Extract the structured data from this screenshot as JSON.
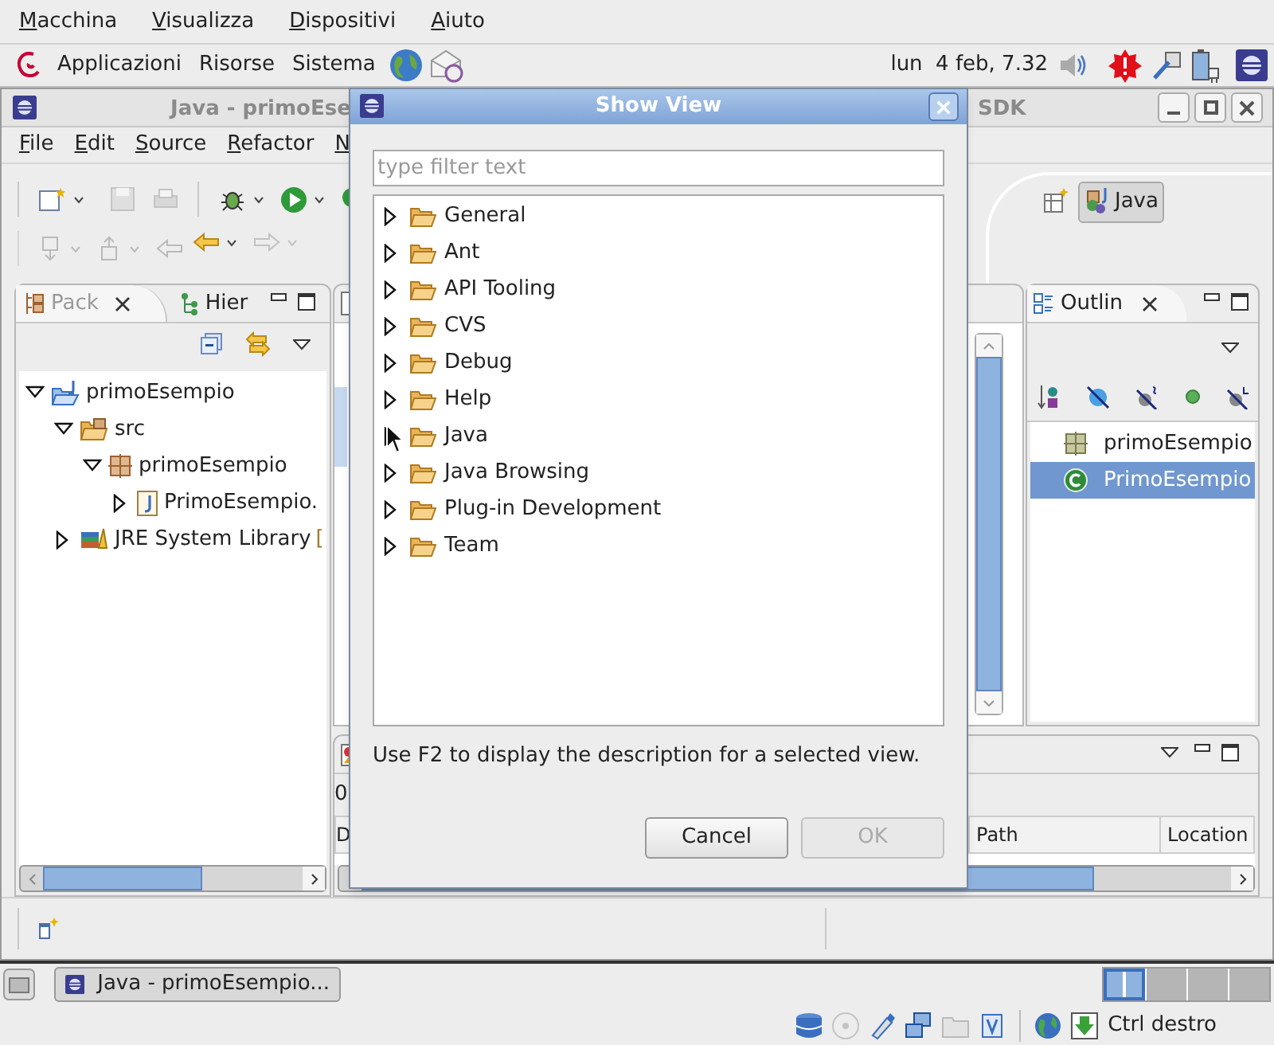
{
  "vm_menu": [
    "Macchina",
    "Visualizza",
    "Dispositivi",
    "Aiuto"
  ],
  "panel": {
    "menus": [
      "Applicazioni",
      "Risorse",
      "Sistema"
    ],
    "clock": "lun  4 feb, 7.32"
  },
  "eclipse": {
    "title": "Java - primoEse",
    "title_end": "SDK",
    "menu": [
      "File",
      "Edit",
      "Source",
      "Refactor",
      "N"
    ],
    "perspective": "Java",
    "package_explorer": {
      "tabs": [
        {
          "label": "Pack",
          "selected": true
        },
        {
          "label": "Hier",
          "selected": false
        }
      ],
      "tree": [
        {
          "label": "primoEsempio",
          "kind": "project",
          "expanded": true,
          "children": [
            {
              "label": "src",
              "kind": "source-folder",
              "expanded": true,
              "children": [
                {
                  "label": "primoEsempio",
                  "kind": "package",
                  "expanded": true,
                  "children": [
                    {
                      "label": "PrimoEsempio.",
                      "kind": "java-file",
                      "expanded": false
                    }
                  ]
                }
              ]
            },
            {
              "label": "JRE System Library",
              "decoration": "[",
              "kind": "library",
              "expanded": false
            }
          ]
        }
      ]
    },
    "outline": {
      "tab": "Outlin",
      "items": [
        {
          "label": "primoEsempio",
          "kind": "package",
          "selected": false
        },
        {
          "label": "PrimoEsempio",
          "kind": "class",
          "selected": true
        }
      ]
    },
    "bottom_panel": {
      "count": "0",
      "columns": [
        "D",
        "Path",
        "Location"
      ]
    }
  },
  "dialog": {
    "title": "Show View",
    "filter_placeholder": "type filter text",
    "categories": [
      {
        "label": "General",
        "expanded": false
      },
      {
        "label": "Ant",
        "expanded": false
      },
      {
        "label": "API Tooling",
        "expanded": false
      },
      {
        "label": "CVS",
        "expanded": false
      },
      {
        "label": "Debug",
        "expanded": false
      },
      {
        "label": "Help",
        "expanded": false
      },
      {
        "label": "Java",
        "expanded": false
      },
      {
        "label": "Java Browsing",
        "expanded": false
      },
      {
        "label": "Plug-in Development",
        "expanded": false
      },
      {
        "label": "Team",
        "expanded": false
      }
    ],
    "hint": "Use F2 to display the description for a selected view.",
    "buttons": [
      {
        "label": "Cancel",
        "disabled": false
      },
      {
        "label": "OK",
        "disabled": true
      }
    ]
  },
  "taskbar": {
    "tasks": [
      "Java - primoEsempio..."
    ]
  },
  "vm_status": {
    "host_key": "Ctrl destro"
  }
}
